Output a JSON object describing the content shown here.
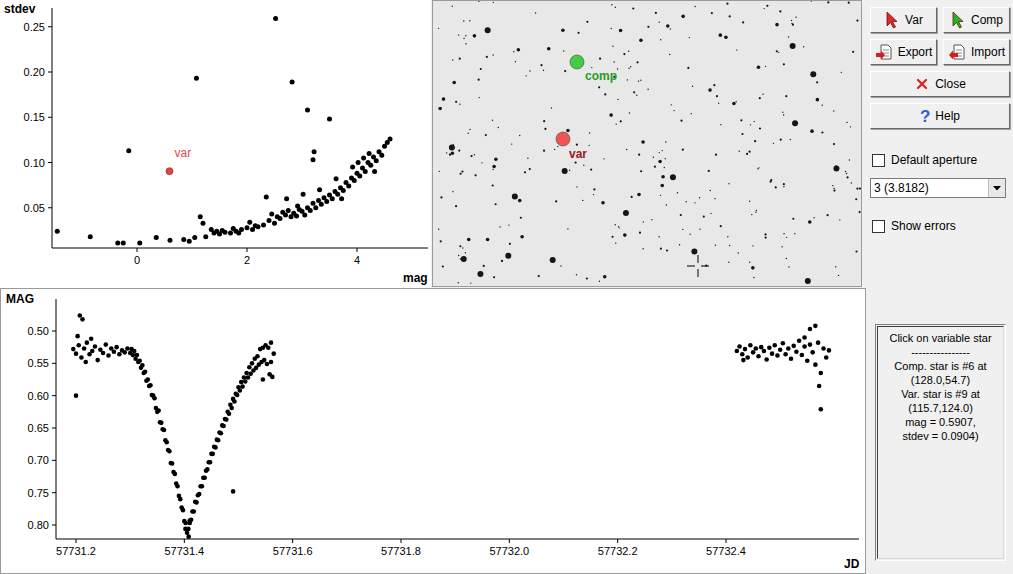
{
  "toolbar": [
    {
      "label": "Var",
      "kind": "cursor",
      "color": "#e02828",
      "selected": false
    },
    {
      "label": "Comp",
      "kind": "cursor",
      "color": "#22b822",
      "selected": false
    },
    {
      "label": "Export",
      "kind": "export",
      "color": "#d02020",
      "selected": false
    },
    {
      "label": "Import",
      "kind": "import",
      "color": "#d02020",
      "selected": false
    }
  ],
  "close_button": {
    "label": "Close"
  },
  "help_button": {
    "label": "Help",
    "icon_text": "?"
  },
  "default_aperture": {
    "label": "Default aperture",
    "checked": false
  },
  "aperture_select": {
    "value": "3 (3.8182)"
  },
  "show_errors": {
    "label": "Show errors",
    "checked": false
  },
  "info": [
    "Click on variable star",
    "----------------",
    "Comp. star is #6 at",
    "(128.0,54.7)",
    "Var. star is #9 at",
    "(115.7,124.0)",
    "mag = 0.5907,",
    "stdev = 0.0904)"
  ],
  "scatter": {
    "x_label": "mag",
    "y_label": "stdev",
    "x_ticks": [
      {
        "value": 0,
        "label": "0"
      },
      {
        "value": 2,
        "label": "2"
      },
      {
        "value": 4,
        "label": "4"
      }
    ],
    "y_ticks": [
      {
        "value": 0.05,
        "label": "0.05"
      },
      {
        "value": 0.1,
        "label": "0.10"
      },
      {
        "value": 0.15,
        "label": "0.15"
      },
      {
        "value": 0.2,
        "label": "0.20"
      },
      {
        "value": 0.25,
        "label": "0.25"
      }
    ],
    "variable": {
      "mag": 0.5907,
      "stdev": 0.0904,
      "label": "var",
      "color": "#e04848"
    },
    "points": [
      [
        -1.45,
        0.024
      ],
      [
        -0.85,
        0.018
      ],
      [
        -0.35,
        0.011
      ],
      [
        -0.25,
        0.011
      ],
      [
        -0.15,
        0.113
      ],
      [
        0.05,
        0.011
      ],
      [
        0.35,
        0.017
      ],
      [
        0.6,
        0.014
      ],
      [
        0.85,
        0.015
      ],
      [
        0.95,
        0.013
      ],
      [
        1.05,
        0.017
      ],
      [
        1.08,
        0.193
      ],
      [
        1.15,
        0.04
      ],
      [
        1.2,
        0.033
      ],
      [
        1.25,
        0.018
      ],
      [
        1.35,
        0.026
      ],
      [
        1.4,
        0.022
      ],
      [
        1.45,
        0.024
      ],
      [
        1.5,
        0.021
      ],
      [
        1.55,
        0.025
      ],
      [
        1.6,
        0.023
      ],
      [
        1.7,
        0.022
      ],
      [
        1.75,
        0.027
      ],
      [
        1.8,
        0.024
      ],
      [
        1.85,
        0.022
      ],
      [
        1.9,
        0.026
      ],
      [
        2.0,
        0.028
      ],
      [
        2.05,
        0.034
      ],
      [
        2.1,
        0.026
      ],
      [
        2.15,
        0.03
      ],
      [
        2.2,
        0.029
      ],
      [
        2.3,
        0.031
      ],
      [
        2.35,
        0.062
      ],
      [
        2.4,
        0.036
      ],
      [
        2.45,
        0.043
      ],
      [
        2.5,
        0.033
      ],
      [
        2.52,
        0.259
      ],
      [
        2.55,
        0.04
      ],
      [
        2.6,
        0.038
      ],
      [
        2.65,
        0.045
      ],
      [
        2.7,
        0.042
      ],
      [
        2.72,
        0.06
      ],
      [
        2.75,
        0.047
      ],
      [
        2.8,
        0.04
      ],
      [
        2.82,
        0.189
      ],
      [
        2.85,
        0.044
      ],
      [
        2.9,
        0.041
      ],
      [
        2.92,
        0.052
      ],
      [
        2.95,
        0.048
      ],
      [
        3.0,
        0.046
      ],
      [
        3.02,
        0.065
      ],
      [
        3.05,
        0.042
      ],
      [
        3.1,
        0.05
      ],
      [
        3.1,
        0.158
      ],
      [
        3.15,
        0.047
      ],
      [
        3.2,
        0.055
      ],
      [
        3.2,
        0.103
      ],
      [
        3.22,
        0.112
      ],
      [
        3.25,
        0.05
      ],
      [
        3.3,
        0.058
      ],
      [
        3.32,
        0.07
      ],
      [
        3.35,
        0.054
      ],
      [
        3.4,
        0.061
      ],
      [
        3.45,
        0.057
      ],
      [
        3.5,
        0.064
      ],
      [
        3.5,
        0.148
      ],
      [
        3.55,
        0.06
      ],
      [
        3.6,
        0.068
      ],
      [
        3.62,
        0.082
      ],
      [
        3.65,
        0.065
      ],
      [
        3.7,
        0.072
      ],
      [
        3.72,
        0.06
      ],
      [
        3.75,
        0.069
      ],
      [
        3.8,
        0.078
      ],
      [
        3.85,
        0.074
      ],
      [
        3.9,
        0.083
      ],
      [
        3.92,
        0.095
      ],
      [
        3.95,
        0.08
      ],
      [
        4.0,
        0.088
      ],
      [
        4.02,
        0.1
      ],
      [
        4.05,
        0.085
      ],
      [
        4.1,
        0.094
      ],
      [
        4.12,
        0.105
      ],
      [
        4.15,
        0.09
      ],
      [
        4.2,
        0.1
      ],
      [
        4.22,
        0.11
      ],
      [
        4.25,
        0.097
      ],
      [
        4.3,
        0.106
      ],
      [
        4.32,
        0.09
      ],
      [
        4.35,
        0.102
      ],
      [
        4.4,
        0.112
      ],
      [
        4.45,
        0.108
      ],
      [
        4.5,
        0.118
      ],
      [
        4.55,
        0.122
      ],
      [
        4.6,
        0.126
      ]
    ]
  },
  "field": {
    "markers": [
      {
        "label": "comp",
        "color": "#44cc44",
        "label_color": "#2a9a2a"
      },
      {
        "label": "var",
        "color": "#ee5555",
        "label_color": "#a01818"
      }
    ]
  },
  "light_curve": {
    "x_label": "JD",
    "y_label": "MAG",
    "x_ticks": [
      {
        "value": 57731.2,
        "label": "57731.2"
      },
      {
        "value": 57731.4,
        "label": "57731.4"
      },
      {
        "value": 57731.6,
        "label": "57731.6"
      },
      {
        "value": 57731.8,
        "label": "57731.8"
      },
      {
        "value": 57732.0,
        "label": "57732.0"
      },
      {
        "value": 57732.2,
        "label": "57732.2"
      },
      {
        "value": 57732.4,
        "label": "57732.4"
      }
    ],
    "y_ticks": [
      {
        "value": 0.5,
        "label": "0.50"
      },
      {
        "value": 0.55,
        "label": "0.55"
      },
      {
        "value": 0.6,
        "label": "0.60"
      },
      {
        "value": 0.65,
        "label": "0.65"
      },
      {
        "value": 0.7,
        "label": "0.70"
      },
      {
        "value": 0.75,
        "label": "0.75"
      },
      {
        "value": 0.8,
        "label": "0.80"
      }
    ],
    "points": [
      [
        57731.195,
        0.528
      ],
      [
        57731.2,
        0.535
      ],
      [
        57731.205,
        0.522
      ],
      [
        57731.21,
        0.541
      ],
      [
        57731.215,
        0.527
      ],
      [
        57731.22,
        0.518
      ],
      [
        57731.225,
        0.536
      ],
      [
        57731.23,
        0.531
      ],
      [
        57731.235,
        0.524
      ],
      [
        57731.24,
        0.545
      ],
      [
        57731.245,
        0.529
      ],
      [
        57731.25,
        0.534
      ],
      [
        57731.255,
        0.521
      ],
      [
        57731.26,
        0.538
      ],
      [
        57731.265,
        0.527
      ],
      [
        57731.27,
        0.532
      ],
      [
        57731.275,
        0.525
      ],
      [
        57731.28,
        0.536
      ],
      [
        57731.285,
        0.53
      ],
      [
        57731.29,
        0.533
      ],
      [
        57731.295,
        0.527
      ],
      [
        57731.2,
        0.6
      ],
      [
        57731.207,
        0.476
      ],
      [
        57731.212,
        0.482
      ],
      [
        57731.218,
        0.548
      ],
      [
        57731.203,
        0.508
      ],
      [
        57731.228,
        0.512
      ],
      [
        57731.3,
        0.534
      ],
      [
        57731.3025,
        0.528
      ],
      [
        57731.305,
        0.537
      ],
      [
        57731.3075,
        0.531
      ],
      [
        57731.31,
        0.543
      ],
      [
        57731.3125,
        0.537
      ],
      [
        57731.315,
        0.548
      ],
      [
        57731.3175,
        0.546
      ],
      [
        57731.32,
        0.557
      ],
      [
        57731.3225,
        0.553
      ],
      [
        57731.325,
        0.565
      ],
      [
        57731.3275,
        0.563
      ],
      [
        57731.33,
        0.577
      ],
      [
        57731.3325,
        0.575
      ],
      [
        57731.335,
        0.585
      ],
      [
        57731.3375,
        0.584
      ],
      [
        57731.34,
        0.599
      ],
      [
        57731.3425,
        0.6
      ],
      [
        57731.345,
        0.604
      ],
      [
        57731.3475,
        0.619
      ],
      [
        57731.35,
        0.625
      ],
      [
        57731.3525,
        0.623
      ],
      [
        57731.355,
        0.641
      ],
      [
        57731.3575,
        0.642
      ],
      [
        57731.36,
        0.652
      ],
      [
        57731.3625,
        0.653
      ],
      [
        57731.365,
        0.669
      ],
      [
        57731.3675,
        0.672
      ],
      [
        57731.37,
        0.684
      ],
      [
        57731.3725,
        0.686
      ],
      [
        57731.375,
        0.704
      ],
      [
        57731.3775,
        0.705
      ],
      [
        57731.38,
        0.718
      ],
      [
        57731.3825,
        0.721
      ],
      [
        57731.385,
        0.736
      ],
      [
        57731.3875,
        0.74
      ],
      [
        57731.39,
        0.755
      ],
      [
        57731.3925,
        0.76
      ],
      [
        57731.395,
        0.773
      ],
      [
        57731.3975,
        0.777
      ],
      [
        57731.4,
        0.794
      ],
      [
        57731.4025,
        0.797
      ],
      [
        57731.405,
        0.812
      ],
      [
        57731.402,
        0.806
      ],
      [
        57731.408,
        0.818
      ],
      [
        57731.41,
        0.797
      ],
      [
        57731.4075,
        0.806
      ],
      [
        57731.41,
        0.793
      ],
      [
        57731.4125,
        0.792
      ],
      [
        57731.415,
        0.779
      ],
      [
        57731.4175,
        0.779
      ],
      [
        57731.42,
        0.764
      ],
      [
        57731.4225,
        0.765
      ],
      [
        57731.425,
        0.754
      ],
      [
        57731.4275,
        0.752
      ],
      [
        57731.43,
        0.74
      ],
      [
        57731.4325,
        0.74
      ],
      [
        57731.435,
        0.727
      ],
      [
        57731.4375,
        0.727
      ],
      [
        57731.44,
        0.716
      ],
      [
        57731.4425,
        0.714
      ],
      [
        57731.445,
        0.703
      ],
      [
        57731.4475,
        0.703
      ],
      [
        57731.45,
        0.69
      ],
      [
        57731.4525,
        0.69
      ],
      [
        57731.455,
        0.679
      ],
      [
        57731.4575,
        0.68
      ],
      [
        57731.46,
        0.668
      ],
      [
        57731.4625,
        0.669
      ],
      [
        57731.465,
        0.657
      ],
      [
        57731.4675,
        0.658
      ],
      [
        57731.47,
        0.646
      ],
      [
        57731.4725,
        0.647
      ],
      [
        57731.475,
        0.636
      ],
      [
        57731.4775,
        0.637
      ],
      [
        57731.48,
        0.625
      ],
      [
        57731.4825,
        0.628
      ],
      [
        57731.485,
        0.614
      ],
      [
        57731.4875,
        0.619
      ],
      [
        57731.49,
        0.605
      ],
      [
        57731.4925,
        0.609
      ],
      [
        57731.495,
        0.597
      ],
      [
        57731.4975,
        0.599
      ],
      [
        57731.5,
        0.587
      ],
      [
        57731.5025,
        0.592
      ],
      [
        57731.505,
        0.579
      ],
      [
        57731.5075,
        0.586
      ],
      [
        57731.51,
        0.572
      ],
      [
        57731.5125,
        0.578
      ],
      [
        57731.515,
        0.565
      ],
      [
        57731.5175,
        0.572
      ],
      [
        57731.52,
        0.556
      ],
      [
        57731.5225,
        0.566
      ],
      [
        57731.525,
        0.55
      ],
      [
        57731.5275,
        0.561
      ],
      [
        57731.53,
        0.543
      ],
      [
        57731.5325,
        0.557
      ],
      [
        57731.535,
        0.539
      ],
      [
        57731.5375,
        0.552
      ],
      [
        57731.54,
        0.528
      ],
      [
        57731.5425,
        0.548
      ],
      [
        57731.545,
        0.526
      ],
      [
        57731.5475,
        0.545
      ],
      [
        57731.55,
        0.522
      ],
      [
        57731.5525,
        0.551
      ],
      [
        57731.555,
        0.526
      ],
      [
        57731.5575,
        0.567
      ],
      [
        57731.56,
        0.548
      ],
      [
        57731.5625,
        0.571
      ],
      [
        57731.565,
        0.535
      ],
      [
        57731.49,
        0.748
      ],
      [
        57731.545,
        0.575
      ],
      [
        57731.56,
        0.518
      ],
      [
        57732.42,
        0.531
      ],
      [
        57732.425,
        0.524
      ],
      [
        57732.43,
        0.536
      ],
      [
        57732.435,
        0.528
      ],
      [
        57732.44,
        0.541
      ],
      [
        57732.445,
        0.522
      ],
      [
        57732.45,
        0.533
      ],
      [
        57732.455,
        0.527
      ],
      [
        57732.46,
        0.539
      ],
      [
        57732.465,
        0.525
      ],
      [
        57732.47,
        0.531
      ],
      [
        57732.475,
        0.544
      ],
      [
        57732.48,
        0.526
      ],
      [
        57732.485,
        0.535
      ],
      [
        57732.49,
        0.522
      ],
      [
        57732.495,
        0.538
      ],
      [
        57732.5,
        0.529
      ],
      [
        57732.505,
        0.519
      ],
      [
        57732.51,
        0.536
      ],
      [
        57732.515,
        0.527
      ],
      [
        57732.52,
        0.543
      ],
      [
        57732.525,
        0.523
      ],
      [
        57732.53,
        0.532
      ],
      [
        57732.535,
        0.515
      ],
      [
        57732.54,
        0.537
      ],
      [
        57732.545,
        0.524
      ],
      [
        57732.55,
        0.546
      ],
      [
        57732.555,
        0.521
      ],
      [
        57732.56,
        0.533
      ],
      [
        57732.565,
        0.552
      ],
      [
        57732.57,
        0.518
      ],
      [
        57732.575,
        0.565
      ],
      [
        57732.58,
        0.527
      ],
      [
        57732.585,
        0.541
      ],
      [
        57732.59,
        0.53
      ],
      [
        57732.555,
        0.497
      ],
      [
        57732.565,
        0.492
      ],
      [
        57732.572,
        0.585
      ],
      [
        57732.575,
        0.621
      ],
      [
        57732.545,
        0.51
      ],
      [
        57732.432,
        0.545
      ]
    ]
  }
}
